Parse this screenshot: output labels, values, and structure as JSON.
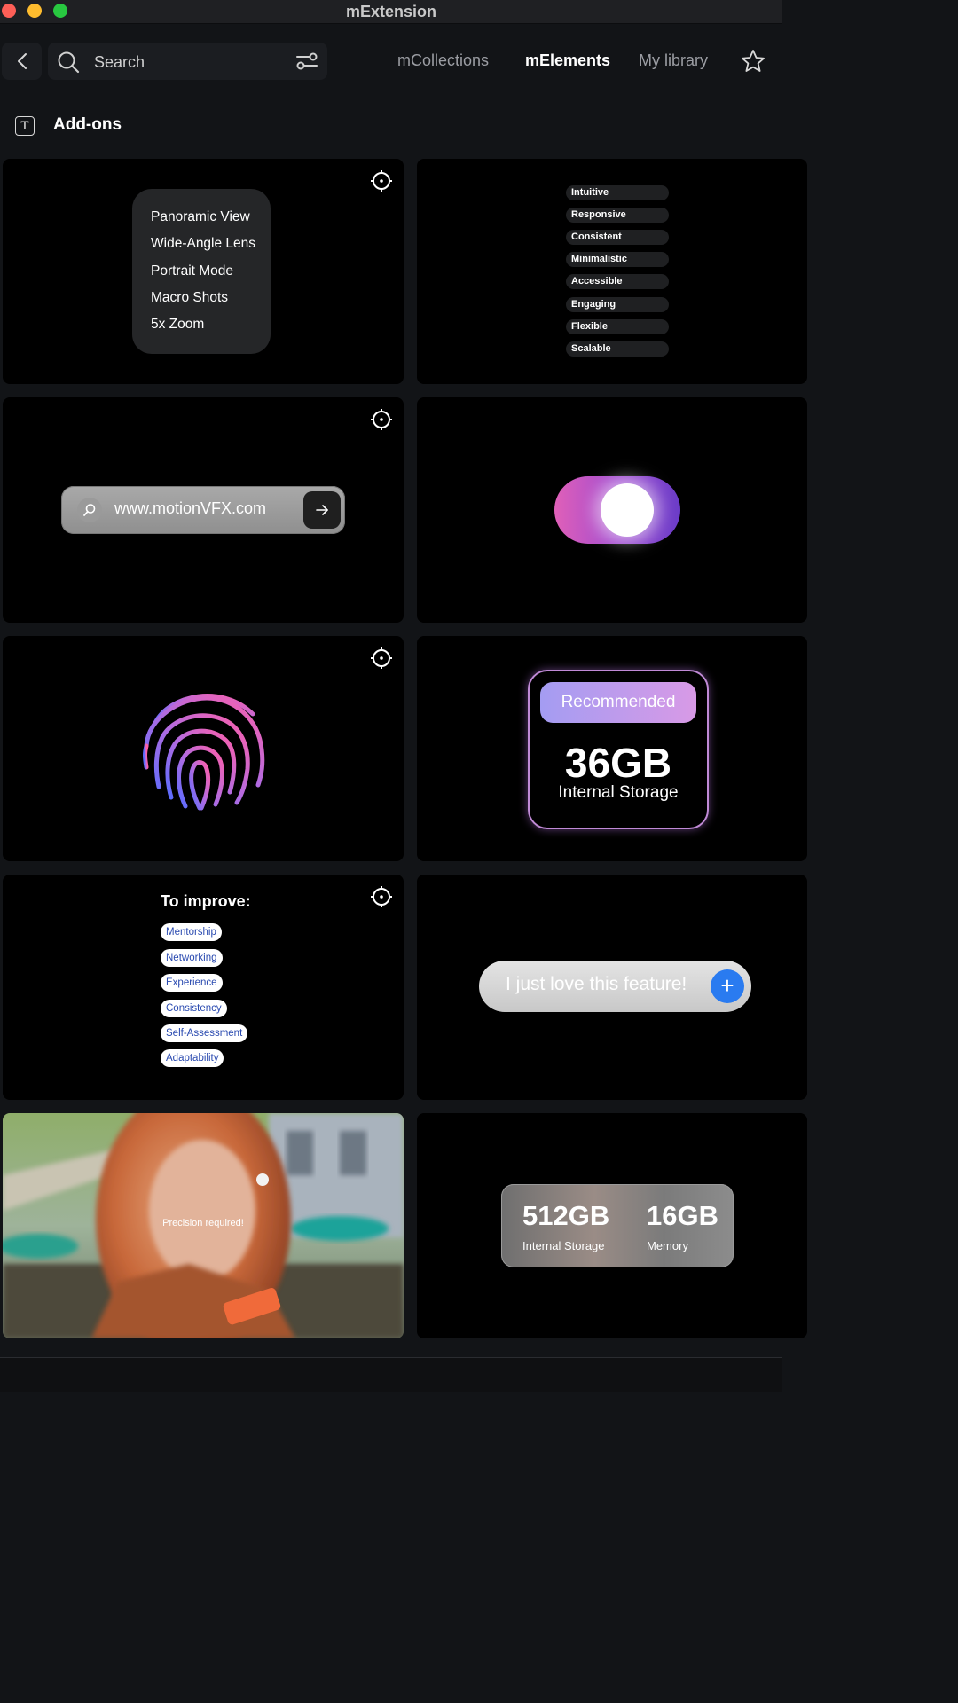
{
  "window": {
    "title": "mExtension"
  },
  "toolbar": {
    "search_placeholder": "Search",
    "tabs": [
      {
        "label": "mCollections",
        "active": false
      },
      {
        "label": "mElements",
        "active": true
      },
      {
        "label": "My library",
        "active": false
      }
    ]
  },
  "section": {
    "icon_letter": "T",
    "title": "Add-ons"
  },
  "cards": {
    "camera_modes": {
      "items": [
        "Panoramic View",
        "Wide-Angle Lens",
        "Portrait Mode",
        "Macro Shots",
        "5x Zoom"
      ]
    },
    "qualities": {
      "items": [
        "Intuitive",
        "Responsive",
        "Consistent",
        "Minimalistic",
        "Accessible",
        "Engaging",
        "Flexible",
        "Scalable"
      ]
    },
    "url_bar": {
      "url": "www.motionVFX.com"
    },
    "toggle": {
      "state": "on"
    },
    "fingerprint": {
      "icon": "fingerprint-icon"
    },
    "storage_badge": {
      "badge": "Recommended",
      "value": "36GB",
      "label": "Internal Storage"
    },
    "improve": {
      "title": "To improve:",
      "chips": [
        "Mentorship",
        "Networking",
        "Experience",
        "Consistency",
        "Self-Assessment",
        "Adaptability"
      ]
    },
    "message": {
      "text": "I just love this feature!"
    },
    "photo": {
      "caption": "Precision required!"
    },
    "specs": {
      "storage_value": "512GB",
      "storage_label": "Internal Storage",
      "memory_value": "16GB",
      "memory_label": "Memory"
    }
  },
  "colors": {
    "background": "#121417",
    "card": "#000000",
    "accent_blue": "#2a7bf0",
    "toggle_pink": "#e060b8",
    "toggle_purple": "#6a3cc8"
  }
}
